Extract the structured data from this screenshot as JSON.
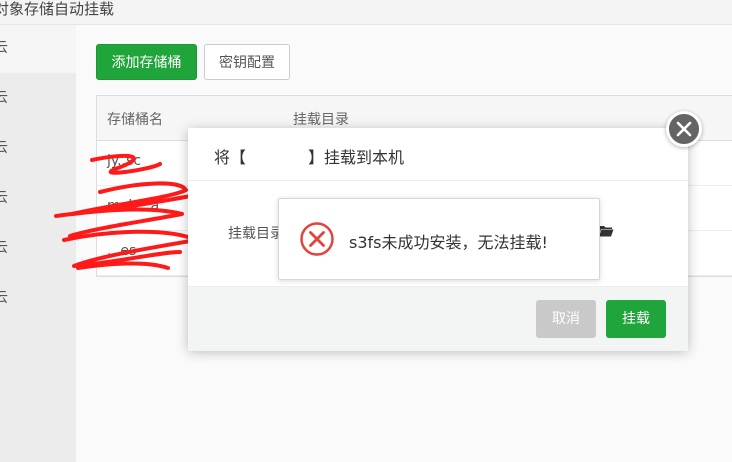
{
  "page": {
    "title": "对象存储自动挂载"
  },
  "sidebar": {
    "items": [
      {
        "label": "云"
      },
      {
        "label": "云"
      },
      {
        "label": "云"
      },
      {
        "label": "云"
      },
      {
        "label": "云"
      },
      {
        "label": "云"
      }
    ]
  },
  "toolbar": {
    "add_bucket_label": "添加存储桶",
    "key_config_label": "密钥配置"
  },
  "table": {
    "columns": [
      "存储桶名",
      "挂载目录"
    ],
    "rows": [
      {
        "bucket": "jy..sc"
      },
      {
        "bucket": "mcb...a"
      },
      {
        "bucket": "...es"
      }
    ]
  },
  "modal": {
    "title_prefix": "将【",
    "title_suffix": "】挂载到本机",
    "mount_dir_label": "挂载目录",
    "cancel_label": "取消",
    "mount_label": "挂载"
  },
  "toast": {
    "message": "s3fs未成功安装，无法挂载!"
  },
  "colors": {
    "accent": "#20a53a",
    "error": "#e0443e",
    "close_bg": "#646464",
    "redaction": "#ff1a1a"
  },
  "icons": {
    "close": "close-icon",
    "error": "error-x-icon",
    "folder": "folder-icon"
  }
}
